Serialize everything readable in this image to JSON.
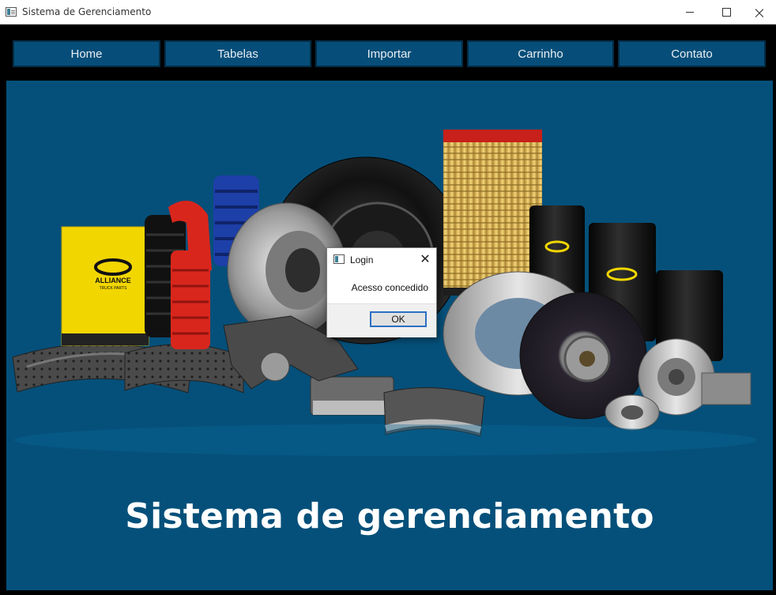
{
  "window": {
    "title": "Sistema de Gerenciamento",
    "icon": "app-window-icon",
    "controls": {
      "minimize": "minimize-icon",
      "maximize": "maximize-icon",
      "close": "×"
    }
  },
  "nav": {
    "items": [
      "Home",
      "Tabelas",
      "Importar",
      "Carrinho",
      "Contato"
    ]
  },
  "hero": {
    "title": "Sistema de gerenciamento",
    "image": {
      "description_icon": "truck-parts-collage-image",
      "brand_label": "ALLIANCE",
      "brand_sub": "TRUCK PARTS"
    }
  },
  "dialog": {
    "title": "Login",
    "message": "Acesso concedido",
    "close": "✕",
    "ok_label": "OK"
  },
  "colors": {
    "hero_bg": "#05507a",
    "nav_button_bg": "#064e79",
    "window_bg": "#000000",
    "accent_yellow": "#f2d600",
    "hose_red": "#d9261c",
    "hose_blue": "#1d3fa8"
  }
}
